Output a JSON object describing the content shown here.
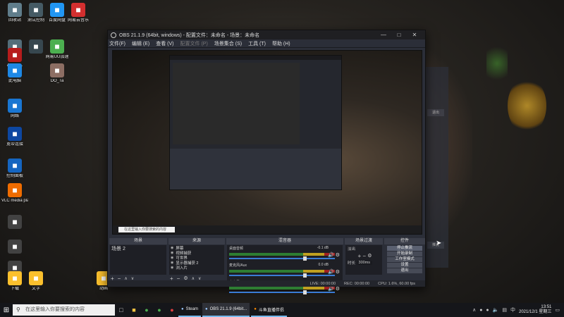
{
  "desktop_icons": [
    {
      "label": "回收站",
      "icon": "recycle-bin-icon",
      "color": "#607d8b"
    },
    {
      "label": "测试控制",
      "icon": "app-icon",
      "color": "#455a64"
    },
    {
      "label": "百度网盘",
      "icon": "baidu-netdisk-icon",
      "color": "#2196f3"
    },
    {
      "label": "网易云音乐",
      "icon": "netease-music-icon",
      "color": "#d32f2f"
    },
    {
      "label": "",
      "icon": "app-icon",
      "color": "#546e7a"
    },
    {
      "label": "Adobe...",
      "icon": "adobe-icon",
      "color": "#b71c1c"
    },
    {
      "label": "",
      "icon": "app-icon",
      "color": "#37474f"
    },
    {
      "label": "网易UU加速",
      "icon": "uu-icon",
      "color": "#4caf50"
    },
    {
      "label": "此电脑",
      "icon": "computer-icon",
      "color": "#1e88e5"
    },
    {
      "label": "DO_Ta",
      "icon": "folder-icon",
      "color": "#8d6e63"
    },
    {
      "label": "网络",
      "icon": "network-icon",
      "color": "#1976d2"
    },
    {
      "label": "宽带连接",
      "icon": "broadband-icon",
      "color": "#0d47a1"
    },
    {
      "label": "控制面板",
      "icon": "control-panel-icon",
      "color": "#1565c0"
    },
    {
      "label": "VLC media player",
      "icon": "vlc-icon",
      "color": "#ef6c00"
    },
    {
      "label": "",
      "icon": "app-icon",
      "color": "#424242"
    },
    {
      "label": "",
      "icon": "app-icon",
      "color": "#424242"
    },
    {
      "label": "",
      "icon": "app-icon",
      "color": "#424242"
    },
    {
      "label": "下载",
      "icon": "folder-icon",
      "color": "#fbc02d"
    },
    {
      "label": "文字",
      "icon": "folder-icon",
      "color": "#fbc02d"
    },
    {
      "label": "动画",
      "icon": "folder-icon",
      "color": "#fbc02d"
    }
  ],
  "obs": {
    "title": "OBS 21.1.9 (64bit, windows) - 配置文件：未命名 - 场景：未命名",
    "menu": [
      {
        "label": "文件(F)",
        "dim": false
      },
      {
        "label": "编辑 (E)",
        "dim": false
      },
      {
        "label": "查看 (V)",
        "dim": false
      },
      {
        "label": "配置文件 (P)",
        "dim": true
      },
      {
        "label": "场景集合 (S)",
        "dim": false
      },
      {
        "label": "工具 (T)",
        "dim": false
      },
      {
        "label": "帮助 (H)",
        "dim": false
      }
    ],
    "nested_search": "在这里输入你要搜索的内容",
    "docks": {
      "scenes": {
        "title": "场景",
        "items": [
          "场景 2"
        ]
      },
      "sources": {
        "title": "来源",
        "items": [
          "屏幕",
          "视频捕获",
          "可世界",
          "显示器捕获 2",
          "浏入片"
        ]
      },
      "mixer": {
        "title": "混音器",
        "channels": [
          {
            "name": "桌面音频",
            "db": "-0.1 dB"
          },
          {
            "name": "麦克风/Aux",
            "db": "0.0 dB"
          },
          {
            "name": "麦克风/Aux",
            "db": ""
          }
        ]
      },
      "transitions": {
        "title": "场景过渡",
        "type": "淡出",
        "duration_label": "时长",
        "duration": "300ms"
      },
      "controls": {
        "title": "控件",
        "buttons": [
          "停止推流",
          "开始录制",
          "工作室模式",
          "设置",
          "退出"
        ]
      }
    },
    "status": {
      "live": "LIVE: 00:00:00",
      "rec": "REC: 00:00:00",
      "cpu": "CPU: 1.6%, 60.00 fps"
    }
  },
  "right_panel": {
    "labels": [
      "退出",
      "推流"
    ]
  },
  "taskbar": {
    "search_placeholder": "在这里输入你要搜索的内容",
    "apps": [
      {
        "label": "Steam",
        "icon": "steam-icon"
      },
      {
        "label": "OBS 21.1.9 (64bit...",
        "icon": "obs-icon"
      },
      {
        "label": "斗鱼直播伴侣",
        "icon": "douyu-icon"
      }
    ],
    "time": "13:51",
    "date": "2021/12/1 星期三",
    "ime": "中"
  }
}
